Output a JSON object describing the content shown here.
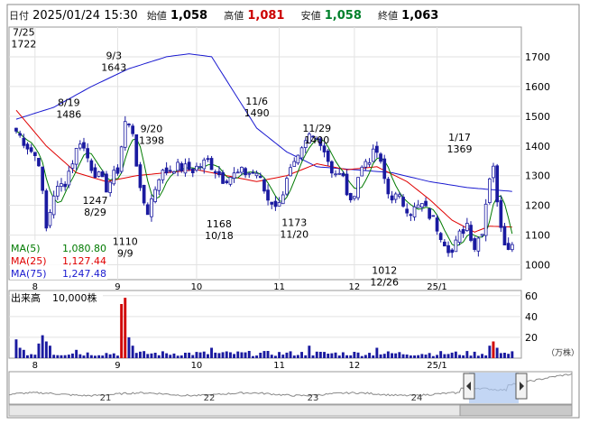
{
  "header": {
    "date_label": "日付",
    "datetime": "2025/01/24 15:30",
    "open_label": "始値",
    "open": "1,058",
    "high_label": "高値",
    "high": "1,081",
    "low_label": "安値",
    "low": "1,058",
    "close_label": "終値",
    "close": "1,063"
  },
  "legend": {
    "ma5": "MA(5)",
    "ma5_value": "1,080.80",
    "ma25": "MA(25)",
    "ma25_value": "1,127.44",
    "ma75": "MA(75)",
    "ma75_value": "1,247.48"
  },
  "volume_label": "出来高",
  "volume_unit": "10,000株",
  "volume_axis_unit": "（万株）",
  "colors": {
    "up": "#ffffff",
    "down": "#1a1aa0",
    "ma5": "#007a00",
    "ma25": "#e00000",
    "ma75": "#1a1ad0",
    "volume": "#1a1aa0",
    "volume_up": "#d00000",
    "navigator_fill": "#aac4ef",
    "navigator_line": "#888888"
  },
  "chart_data": [
    {
      "type": "candlestick",
      "ylim": [
        950,
        1800
      ],
      "y_ticks": [
        1000,
        1100,
        1200,
        1300,
        1400,
        1500,
        1600,
        1700
      ],
      "x_tick_labels": [
        "8",
        "9",
        "10",
        "11",
        "12",
        "25/1"
      ],
      "annotations": [
        {
          "date": "7/25",
          "value": "1722",
          "kind": "high"
        },
        {
          "date": "8/19",
          "value": "1486",
          "kind": "high"
        },
        {
          "date": "8/29",
          "value": "1247",
          "kind": "low"
        },
        {
          "date": "9/3",
          "value": "1643",
          "kind": "high"
        },
        {
          "date": "9/9",
          "value": "1110",
          "kind": "low"
        },
        {
          "date": "9/20",
          "value": "1398",
          "kind": "high"
        },
        {
          "date": "10/18",
          "value": "1168",
          "kind": "low"
        },
        {
          "date": "11/6",
          "value": "1490",
          "kind": "high"
        },
        {
          "date": "11/20",
          "value": "1173",
          "kind": "low"
        },
        {
          "date": "11/29",
          "value": "1400",
          "kind": "high"
        },
        {
          "date": "12/26",
          "value": "1012",
          "kind": "low"
        },
        {
          "date": "1/17",
          "value": "1369",
          "kind": "high"
        }
      ],
      "anchors": [
        {
          "i": 0,
          "v": 1450
        },
        {
          "i": 6,
          "v": 1350
        },
        {
          "i": 8,
          "v": 1120
        },
        {
          "i": 10,
          "v": 1240
        },
        {
          "i": 13,
          "v": 1280
        },
        {
          "i": 17,
          "v": 1420
        },
        {
          "i": 20,
          "v": 1330
        },
        {
          "i": 24,
          "v": 1260
        },
        {
          "i": 27,
          "v": 1320
        },
        {
          "i": 29,
          "v": 1480
        },
        {
          "i": 31,
          "v": 1450
        },
        {
          "i": 33,
          "v": 1240
        },
        {
          "i": 35,
          "v": 1180
        },
        {
          "i": 38,
          "v": 1300
        },
        {
          "i": 42,
          "v": 1330
        },
        {
          "i": 47,
          "v": 1320
        },
        {
          "i": 51,
          "v": 1350
        },
        {
          "i": 55,
          "v": 1290
        },
        {
          "i": 60,
          "v": 1310
        },
        {
          "i": 64,
          "v": 1310
        },
        {
          "i": 67,
          "v": 1220
        },
        {
          "i": 70,
          "v": 1200
        },
        {
          "i": 72,
          "v": 1300
        },
        {
          "i": 75,
          "v": 1350
        },
        {
          "i": 78,
          "v": 1430
        },
        {
          "i": 81,
          "v": 1420
        },
        {
          "i": 84,
          "v": 1320
        },
        {
          "i": 87,
          "v": 1290
        },
        {
          "i": 89,
          "v": 1200
        },
        {
          "i": 91,
          "v": 1300
        },
        {
          "i": 93,
          "v": 1350
        },
        {
          "i": 96,
          "v": 1380
        },
        {
          "i": 99,
          "v": 1240
        },
        {
          "i": 102,
          "v": 1220
        },
        {
          "i": 105,
          "v": 1180
        },
        {
          "i": 108,
          "v": 1200
        },
        {
          "i": 111,
          "v": 1150
        },
        {
          "i": 114,
          "v": 1080
        },
        {
          "i": 116,
          "v": 1040
        },
        {
          "i": 118,
          "v": 1100
        },
        {
          "i": 120,
          "v": 1140
        },
        {
          "i": 122,
          "v": 1060
        },
        {
          "i": 124,
          "v": 1120
        },
        {
          "i": 126,
          "v": 1300
        },
        {
          "i": 127,
          "v": 1340
        },
        {
          "i": 128,
          "v": 1200
        },
        {
          "i": 130,
          "v": 1080
        },
        {
          "i": 132,
          "v": 1063
        }
      ],
      "ma75_points": [
        {
          "i": 0,
          "v": 1490
        },
        {
          "i": 10,
          "v": 1530
        },
        {
          "i": 20,
          "v": 1600
        },
        {
          "i": 30,
          "v": 1660
        },
        {
          "i": 40,
          "v": 1700
        },
        {
          "i": 46,
          "v": 1710
        },
        {
          "i": 52,
          "v": 1700
        },
        {
          "i": 58,
          "v": 1580
        },
        {
          "i": 64,
          "v": 1460
        },
        {
          "i": 72,
          "v": 1380
        },
        {
          "i": 80,
          "v": 1330
        },
        {
          "i": 90,
          "v": 1320
        },
        {
          "i": 100,
          "v": 1310
        },
        {
          "i": 110,
          "v": 1280
        },
        {
          "i": 120,
          "v": 1260
        },
        {
          "i": 132,
          "v": 1247
        }
      ],
      "ma25_points": [
        {
          "i": 0,
          "v": 1520
        },
        {
          "i": 8,
          "v": 1400
        },
        {
          "i": 16,
          "v": 1310
        },
        {
          "i": 24,
          "v": 1280
        },
        {
          "i": 32,
          "v": 1300
        },
        {
          "i": 40,
          "v": 1310
        },
        {
          "i": 48,
          "v": 1320
        },
        {
          "i": 56,
          "v": 1300
        },
        {
          "i": 64,
          "v": 1280
        },
        {
          "i": 72,
          "v": 1300
        },
        {
          "i": 80,
          "v": 1340
        },
        {
          "i": 88,
          "v": 1320
        },
        {
          "i": 96,
          "v": 1330
        },
        {
          "i": 104,
          "v": 1280
        },
        {
          "i": 110,
          "v": 1220
        },
        {
          "i": 116,
          "v": 1150
        },
        {
          "i": 122,
          "v": 1110
        },
        {
          "i": 126,
          "v": 1130
        },
        {
          "i": 132,
          "v": 1127
        }
      ]
    },
    {
      "type": "bar",
      "series_name": "出来高",
      "ylim": [
        0,
        65
      ],
      "y_ticks": [
        20,
        40,
        60
      ],
      "x_tick_labels": [
        "8",
        "9",
        "10",
        "11",
        "12",
        "25/1"
      ],
      "high_volume": [
        {
          "i": 0,
          "v": 18
        },
        {
          "i": 1,
          "v": 10
        },
        {
          "i": 2,
          "v": 8
        },
        {
          "i": 6,
          "v": 14
        },
        {
          "i": 7,
          "v": 22
        },
        {
          "i": 8,
          "v": 16
        },
        {
          "i": 9,
          "v": 12
        },
        {
          "i": 16,
          "v": 8
        },
        {
          "i": 28,
          "v": 52
        },
        {
          "i": 29,
          "v": 58
        },
        {
          "i": 30,
          "v": 20
        },
        {
          "i": 31,
          "v": 12
        },
        {
          "i": 52,
          "v": 10
        },
        {
          "i": 78,
          "v": 12
        },
        {
          "i": 96,
          "v": 10
        },
        {
          "i": 126,
          "v": 12
        },
        {
          "i": 127,
          "v": 16
        },
        {
          "i": 128,
          "v": 10
        }
      ]
    },
    {
      "type": "navigator",
      "x_tick_labels": [
        "21",
        "22",
        "23",
        "24"
      ]
    }
  ]
}
